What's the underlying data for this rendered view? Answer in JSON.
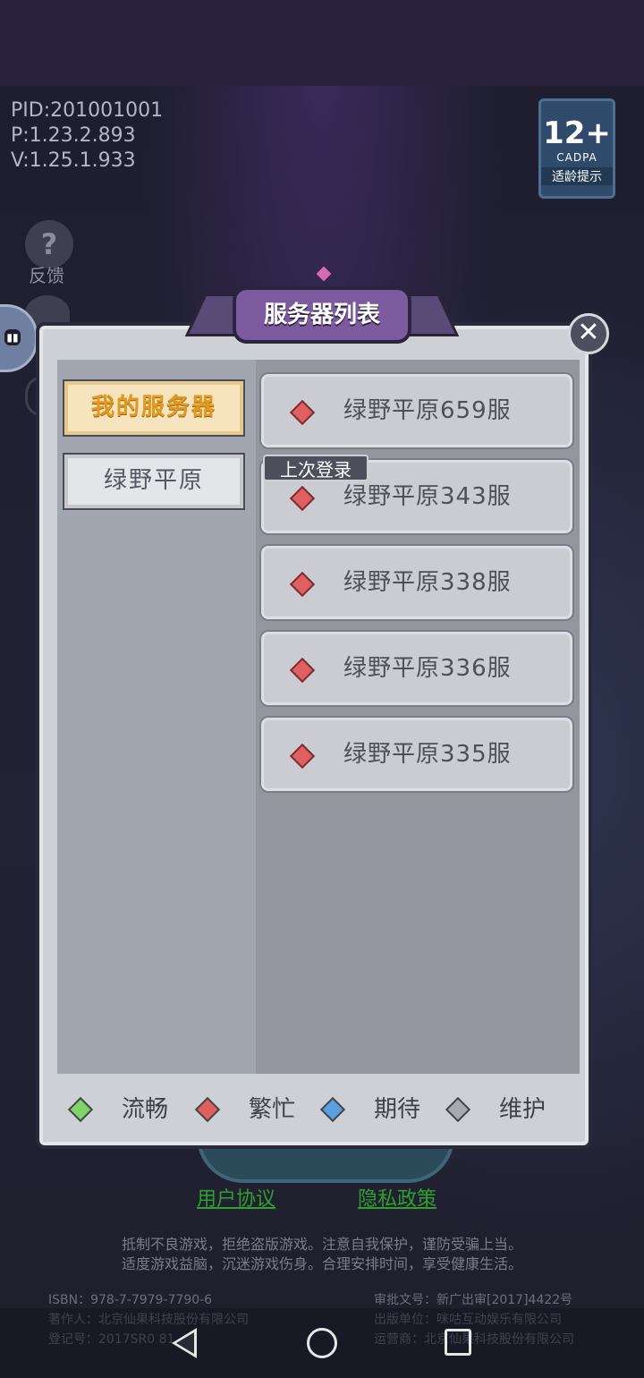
{
  "version": {
    "pid": "PID:201001001",
    "p": "P:1.23.2.893",
    "v": "V:1.25.1.933"
  },
  "age_rating": {
    "number": "12+",
    "org": "CADPA",
    "note": "适龄提示"
  },
  "feedback": {
    "icon": "?",
    "label": "反馈"
  },
  "dialog": {
    "title": "服务器列表",
    "close_icon": "✕",
    "categories": [
      {
        "label": "我的服务器",
        "active": true
      },
      {
        "label": "绿野平原",
        "active": false
      }
    ],
    "last_login_tag": "上次登录",
    "servers": [
      {
        "name": "绿野平原659服",
        "status": "busy"
      },
      {
        "name": "绿野平原343服",
        "status": "busy"
      },
      {
        "name": "绿野平原338服",
        "status": "busy"
      },
      {
        "name": "绿野平原336服",
        "status": "busy"
      },
      {
        "name": "绿野平原335服",
        "status": "busy"
      }
    ],
    "legend": [
      {
        "label": "流畅",
        "color": "#7ed36b"
      },
      {
        "label": "繁忙",
        "color": "#e06060"
      },
      {
        "label": "期待",
        "color": "#5aa0e0"
      },
      {
        "label": "维护",
        "color": "#a8aab0"
      }
    ]
  },
  "links": {
    "user_agreement": "用户协议",
    "privacy_policy": "隐私政策"
  },
  "disclaimer": [
    "抵制不良游戏，拒绝盗版游戏。注意自我保护，谨防受骗上当。",
    "适度游戏益脑，沉迷游戏伤身。合理安排时间，享受健康生活。"
  ],
  "legal": {
    "isbn": "ISBN：978-7-7979-7790-6",
    "author": "著作人：北京仙果科技股份有限公司",
    "reg": "登记号：2017SR0    81",
    "approval": "审批文号：新广出审[2017]4422号",
    "publisher": "出版单位：咪咕互动娱乐有限公司",
    "operator": "运营商：北京仙果科技股份有限公司"
  }
}
